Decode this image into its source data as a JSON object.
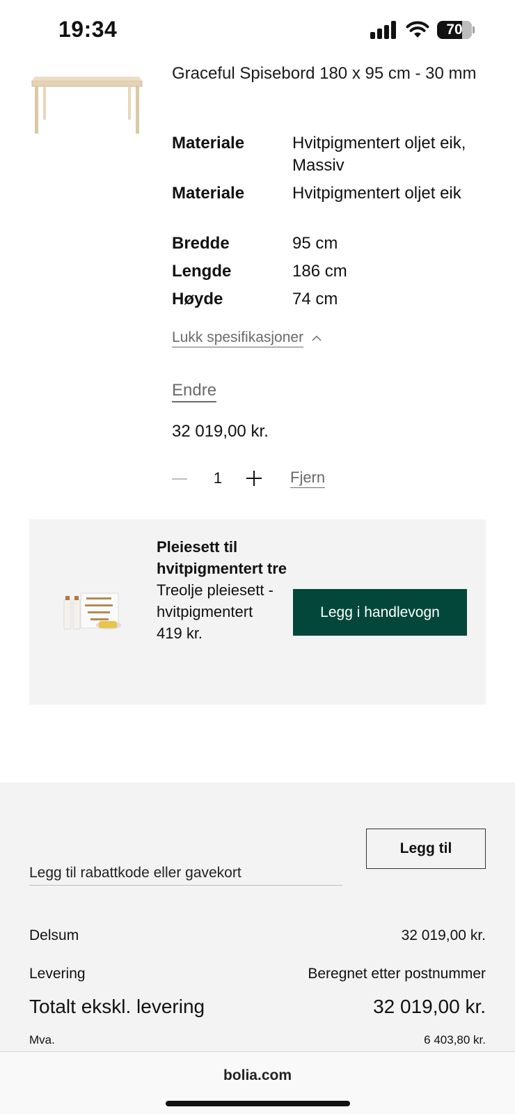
{
  "status_bar": {
    "time": "19:34",
    "battery": "70"
  },
  "product": {
    "title": "Graceful Spisebord 180 x 95 cm - 30 mm",
    "specs": [
      {
        "label": "Materiale",
        "value": "Hvitpigmentert oljet eik, Massiv"
      },
      {
        "label": "Materiale",
        "value": "Hvitpigmentert oljet eik"
      },
      {
        "label": "Bredde",
        "value": "95 cm"
      },
      {
        "label": "Lengde",
        "value": "186 cm"
      },
      {
        "label": "Høyde",
        "value": "74 cm"
      }
    ],
    "close_specs_label": "Lukk spesifikasjoner",
    "change_label": "Endre",
    "price": "32 019,00 kr.",
    "quantity": "1",
    "remove_label": "Fjern"
  },
  "upsell": {
    "title": "Pleiesett til hvitpigmentert tre",
    "subtitle": "Treolje pleiesett - hvitpigmentert",
    "price": "419 kr.",
    "button_label": "Legg i handlevogn",
    "button_color": "#03473b"
  },
  "summary": {
    "coupon_placeholder": "Legg til rabattkode eller gavekort",
    "coupon_button": "Legg til",
    "subtotal_label": "Delsum",
    "subtotal_value": "32 019,00 kr.",
    "delivery_label": "Levering",
    "delivery_value": "Beregnet etter postnummer",
    "total_label": "Totalt ekskl. levering",
    "total_value": "32 019,00 kr.",
    "vat_label": "Mva.",
    "vat_value": "6 403,80 kr."
  },
  "browser": {
    "url": "bolia.com"
  }
}
